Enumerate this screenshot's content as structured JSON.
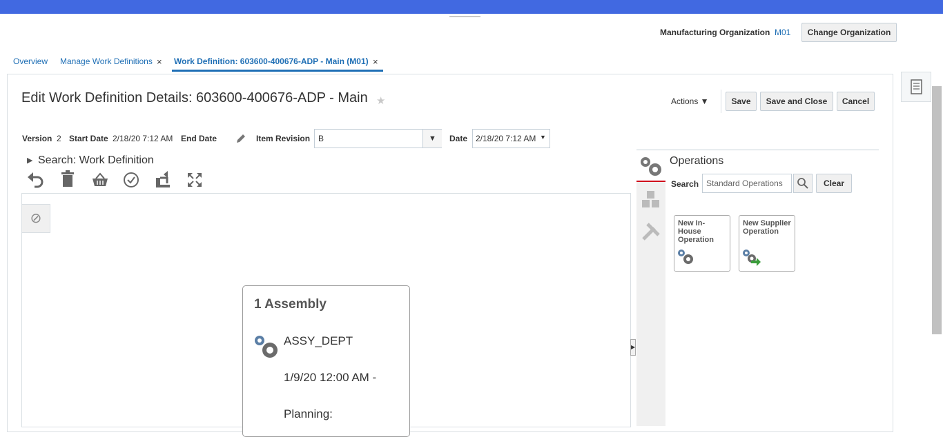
{
  "header": {
    "org_label": "Manufacturing Organization",
    "org_value": "M01",
    "change_org_button": "Change Organization"
  },
  "tabs": [
    {
      "label": "Overview",
      "closable": false
    },
    {
      "label": "Manage Work Definitions",
      "closable": true
    },
    {
      "label": "Work Definition: 603600-400676-ADP - Main (M01)",
      "closable": true,
      "active": true
    }
  ],
  "tab_close_glyph": "×",
  "page": {
    "title": "Edit Work Definition Details: 603600-400676-ADP - Main",
    "favorite_glyph": "★",
    "actions_label": "Actions ▼",
    "save": "Save",
    "save_and_close": "Save and Close",
    "cancel": "Cancel"
  },
  "details": {
    "version_label": "Version",
    "version_value": "2",
    "start_date_label": "Start Date",
    "start_date_value": "2/18/20 7:12 AM",
    "end_date_label": "End Date",
    "item_revision_label": "Item Revision",
    "item_revision_value": "B",
    "date_label": "Date",
    "date_value": "2/18/20 7:12 AM"
  },
  "search_section": {
    "label": "Search: Work Definition"
  },
  "toolbar_icons": [
    "undo-icon",
    "delete-icon",
    "basket-icon",
    "check-icon",
    "export-icon",
    "fullscreen-icon"
  ],
  "operation_card": {
    "title": "1 Assembly",
    "department": "ASSY_DEPT",
    "date": "1/9/20 12:00 AM -",
    "planning": "Planning:"
  },
  "operations_panel": {
    "title": "Operations",
    "search_label": "Search",
    "search_placeholder": "Standard Operations",
    "clear": "Clear",
    "tiles": [
      {
        "label": "New In-House Operation"
      },
      {
        "label": "New Supplier Operation"
      }
    ]
  },
  "colors": {
    "topbar": "#4169e1",
    "link": "#1f6fb5",
    "active_indicator": "#d0021b"
  }
}
